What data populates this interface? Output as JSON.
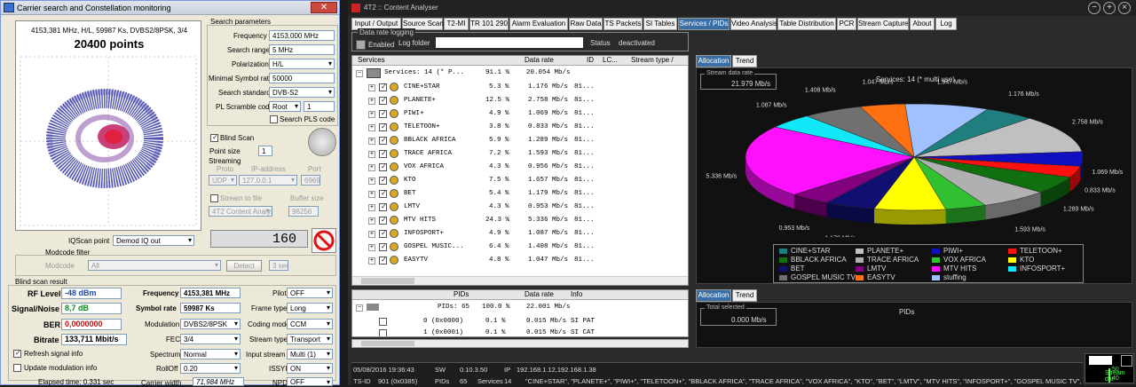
{
  "left_window": {
    "title": "Carrier search and Constellation monitoring",
    "close": "✕",
    "constellation": {
      "info": "4153,381 MHz, H/L, 59987 Ks, DVBS2/8PSK, 3/4",
      "points": "20400 points"
    },
    "search_params": {
      "title": "Search parameters",
      "frequency_label": "Frequency",
      "frequency": "4153,000 MHz",
      "range_label": "Search range",
      "range": "5 MHz",
      "pol_label": "Polarization",
      "pol": "H/L",
      "minsr_label": "Minimal Symbol rate",
      "minsr": "50000",
      "std_label": "Search standard",
      "std": "DVB-S2",
      "pls_label": "PL Scramble code",
      "pls_mode": "Root",
      "pls_val": "1",
      "search_pls": "Search PLS code"
    },
    "blind_scan": "Blind Scan",
    "point_size_label": "Point size",
    "point_size": "1",
    "streaming": {
      "title": "Streaming",
      "proto_h": "Proto",
      "ip_h": "IP-address",
      "port_h": "Port",
      "proto": "UDP",
      "ip": "127.0.0.1",
      "port": "6969",
      "stream_file": "Stream to file",
      "buffer_h": "Buffer size",
      "target": "4T2 Content Analyse",
      "buffer": "96256"
    },
    "lcd": "160",
    "iq_label": "IQScan point",
    "iq": "Demod IQ out",
    "modcode_filter": "Modcode filter",
    "modcode_label": "Modcode",
    "modcode": "All",
    "detect": "Detect",
    "sec": "3 sec",
    "blind_result": "Blind scan result",
    "rf_label": "RF Level",
    "rf": "-48 dBm",
    "snr_label": "Signal/Noise",
    "snr": "8,7 dB",
    "ber_label": "BER",
    "ber": "0,0000000",
    "bitrate_label": "Bitrate",
    "bitrate": "133,711 Mbit/s",
    "freq2_label": "Frequency",
    "freq2": "4153,381 MHz",
    "sr_label": "Symbol rate",
    "sr": "59987 Ks",
    "mod_label": "Modulation",
    "mod": "DVBS2/8PSK",
    "fec_label": "FEC",
    "fec": "3/4",
    "spec_label": "Spectrum",
    "spec": "Normal",
    "roll_label": "RollOff",
    "roll": "0.20",
    "cw_label": "Carrier width",
    "cw": "71,984 MHz",
    "pilot_label": "Pilot",
    "pilot": "OFF",
    "frame_label": "Frame type",
    "frame": "Long",
    "cm_label": "Coding mode",
    "cm": "CCM",
    "st_label": "Stream type",
    "st": "Transport",
    "is_label": "Input stream",
    "is": "Multi (1)",
    "issyi_label": "ISSYI",
    "issyi": "ON",
    "npd_label": "NPD",
    "npd": "OFF",
    "refresh": "Refresh signal info",
    "update_mod": "Update modulation info",
    "elapsed": "Elapsed time: 0.331 sec"
  },
  "right_window": {
    "title": "4T2 :: Content Analyser",
    "tabs": [
      "Input / Output",
      "Source Scan",
      "T2-MI",
      "TR 101 290",
      "Alarm Evaluation",
      "Raw Data",
      "TS Packets",
      "SI Tables",
      "Services / PIDs",
      "Video Analysis",
      "Table Distribution",
      "PCR",
      "Stream Capture",
      "About",
      "Log"
    ],
    "data_rate_logging": {
      "title": "Data rate logging",
      "enabled": "Enabled",
      "folder": "Log folder",
      "status_label": "Status",
      "status": "deactivated"
    },
    "services_table": {
      "headers": [
        "Services",
        "Data rate",
        "ID",
        "LC...",
        "Stream type /"
      ],
      "root": {
        "name": "Services: 14 (* P...",
        "pct": "91.1 %",
        "rate": "20.054 Mb/s"
      },
      "rows": [
        {
          "name": "CINE+STAR",
          "pct": "5.3 %",
          "rate": "1.176 Mb/s",
          "id": "81..."
        },
        {
          "name": "PLANETE+",
          "pct": "12.5 %",
          "rate": "2.758 Mb/s",
          "id": "81..."
        },
        {
          "name": "PIWI+",
          "pct": "4.9 %",
          "rate": "1.069 Mb/s",
          "id": "81..."
        },
        {
          "name": "TELETOON+",
          "pct": "3.8 %",
          "rate": "0.833 Mb/s",
          "id": "81..."
        },
        {
          "name": "BBLACK AFRICA",
          "pct": "5.9 %",
          "rate": "1.289 Mb/s",
          "id": "81..."
        },
        {
          "name": "TRACE AFRICA",
          "pct": "7.2 %",
          "rate": "1.593 Mb/s",
          "id": "81..."
        },
        {
          "name": "VOX AFRICA",
          "pct": "4.3 %",
          "rate": "0.956 Mb/s",
          "id": "81..."
        },
        {
          "name": "KTO",
          "pct": "7.5 %",
          "rate": "1.657 Mb/s",
          "id": "81..."
        },
        {
          "name": "BET",
          "pct": "5.4 %",
          "rate": "1.179 Mb/s",
          "id": "81..."
        },
        {
          "name": "LMTV",
          "pct": "4.3 %",
          "rate": "0.953 Mb/s",
          "id": "81..."
        },
        {
          "name": "MTV HITS",
          "pct": "24.3 %",
          "rate": "5.336 Mb/s",
          "id": "81..."
        },
        {
          "name": "INFOSPORT+",
          "pct": "4.9 %",
          "rate": "1.087 Mb/s",
          "id": "81..."
        },
        {
          "name": "GOSPEL MUSIC...",
          "pct": "6.4 %",
          "rate": "1.408 Mb/s",
          "id": "81..."
        },
        {
          "name": "EASYTV",
          "pct": "4.8 %",
          "rate": "1.047 Mb/s",
          "id": "81..."
        }
      ]
    },
    "pids_table": {
      "headers": [
        "PIDs",
        "Data rate",
        "Info"
      ],
      "root": {
        "name": "PIDs: 65",
        "pct": "100.0 %",
        "rate": "22.001 Mb/s"
      },
      "rows": [
        {
          "name": "0 (0x0000)",
          "pct": "0.1 %",
          "rate": "0.015 Mb/s",
          "info": "SI PAT"
        },
        {
          "name": "1 (0x0001)",
          "pct": "0.1 %",
          "rate": "0.015 Mb/s",
          "info": "SI CAT"
        }
      ]
    },
    "alloc_tabs": [
      "Allocation",
      "Trend"
    ],
    "stream_rate": {
      "title": "Stream data rate",
      "value": "21.979 Mb/s"
    },
    "pie_title": "Services: 14 (* multi use)",
    "total_sel": {
      "title": "Total selected",
      "value": "0.000 Mb/s"
    },
    "pids_label": "PIDs",
    "stream_dat": "Stream dat",
    "stream_dat_ticks": [
      "50",
      "40"
    ],
    "status": {
      "date": "05/08/2016 19:36:43",
      "sw_l": "SW",
      "sw": "0.10.3.50",
      "ip_l": "IP",
      "ip": "192.168.1.12,192.168.1.38",
      "tsid_l": "TS-ID",
      "tsid": "901 (0x0385)",
      "pids_l": "PIDs",
      "pids": "65",
      "svc_l": "Services",
      "svc": "14",
      "svc_list": "\"CINE+STAR\", \"PLANETE+\", \"PIWI+\", \"TELETOON+\", \"BBLACK AFRICA\", \"TRACE AFRICA\", \"VOX AFRICA\", \"KTO\", \"BET\", \"LMTV\", \"MTV HITS\", \"INFOSPORT+\", \"GOSPEL MUSIC TV\", \"EASYTV\""
    }
  },
  "chart_data": {
    "type": "pie",
    "title": "Services: 14 (* multi use)",
    "series": [
      {
        "values": [
          {
            "label": "CINE+STAR",
            "value": 1.176,
            "color": "#1f7f7f"
          },
          {
            "label": "PLANETE+",
            "value": 2.758,
            "color": "#c0c0c0"
          },
          {
            "label": "PIWI+",
            "value": 1.069,
            "color": "#1010c0"
          },
          {
            "label": "TELETOON+",
            "value": 0.833,
            "color": "#ff1010"
          },
          {
            "label": "BBLACK AFRICA",
            "value": 1.289,
            "color": "#107010"
          },
          {
            "label": "TRACE AFRICA",
            "value": 1.593,
            "color": "#b0b0b0"
          },
          {
            "label": "VOX AFRICA",
            "value": 0.956,
            "color": "#30c030"
          },
          {
            "label": "KTO",
            "value": 1.657,
            "color": "#ffff00"
          },
          {
            "label": "BET",
            "value": 1.179,
            "color": "#101070"
          },
          {
            "label": "LMTV",
            "value": 0.953,
            "color": "#800080"
          },
          {
            "label": "MTV HITS",
            "value": 5.336,
            "color": "#ff10ff"
          },
          {
            "label": "INFOSPORT+",
            "value": 1.087,
            "color": "#10e8f8"
          },
          {
            "label": "GOSPEL MUSIC TV",
            "value": 1.408,
            "color": "#707070"
          },
          {
            "label": "EASYTV",
            "value": 1.047,
            "color": "#ff7010"
          },
          {
            "label": "stuffing",
            "value": 1.947,
            "color": "#a0c0ff"
          }
        ]
      }
    ],
    "legend_placement": "bottom"
  }
}
